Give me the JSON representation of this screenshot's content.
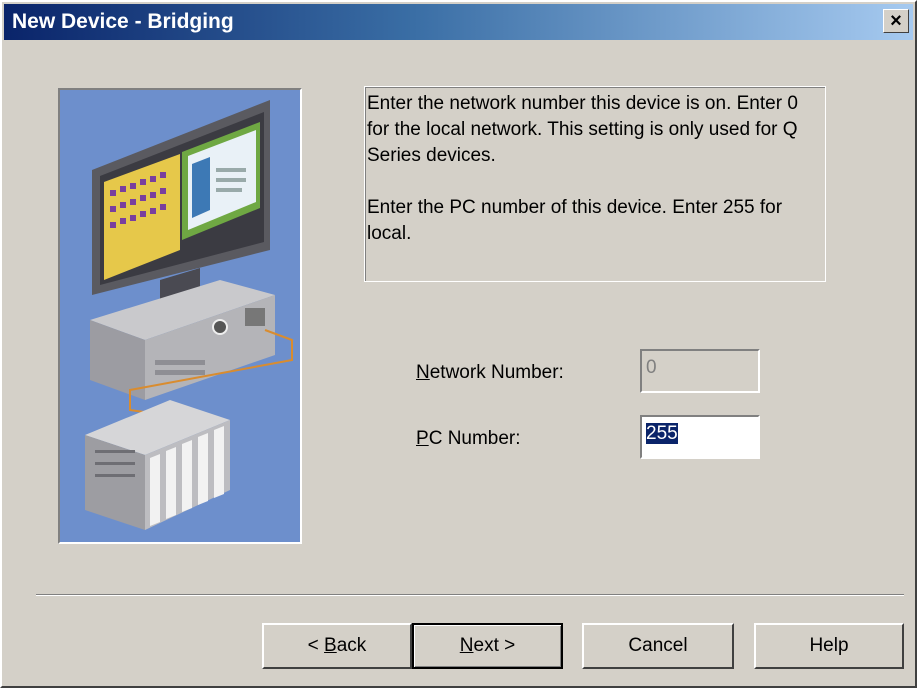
{
  "window": {
    "title": "New Device - Bridging",
    "close_glyph": "✕",
    "close_label": "×"
  },
  "illustration": {
    "icon": "computer-plc-network-illustration",
    "bg_color": "#6d8fcc"
  },
  "info": {
    "paragraph1": "Enter the network number this device is on. Enter 0 for the local network. This setting is only used for Q Series devices.",
    "paragraph2": "Enter the PC number of this device. Enter 255 for local."
  },
  "fields": {
    "network_number": {
      "label_mnemonic": "N",
      "label_rest": "etwork Number:",
      "value": "0",
      "enabled": false
    },
    "pc_number": {
      "label_mnemonic": "P",
      "label_rest": "C Number:",
      "value": "255",
      "selected": true
    }
  },
  "buttons": {
    "back": {
      "prefix": "< ",
      "mnemonic": "B",
      "rest": "ack"
    },
    "next": {
      "mnemonic": "N",
      "rest": "ext >"
    },
    "cancel": {
      "label": "Cancel"
    },
    "help": {
      "label": "Help"
    }
  }
}
